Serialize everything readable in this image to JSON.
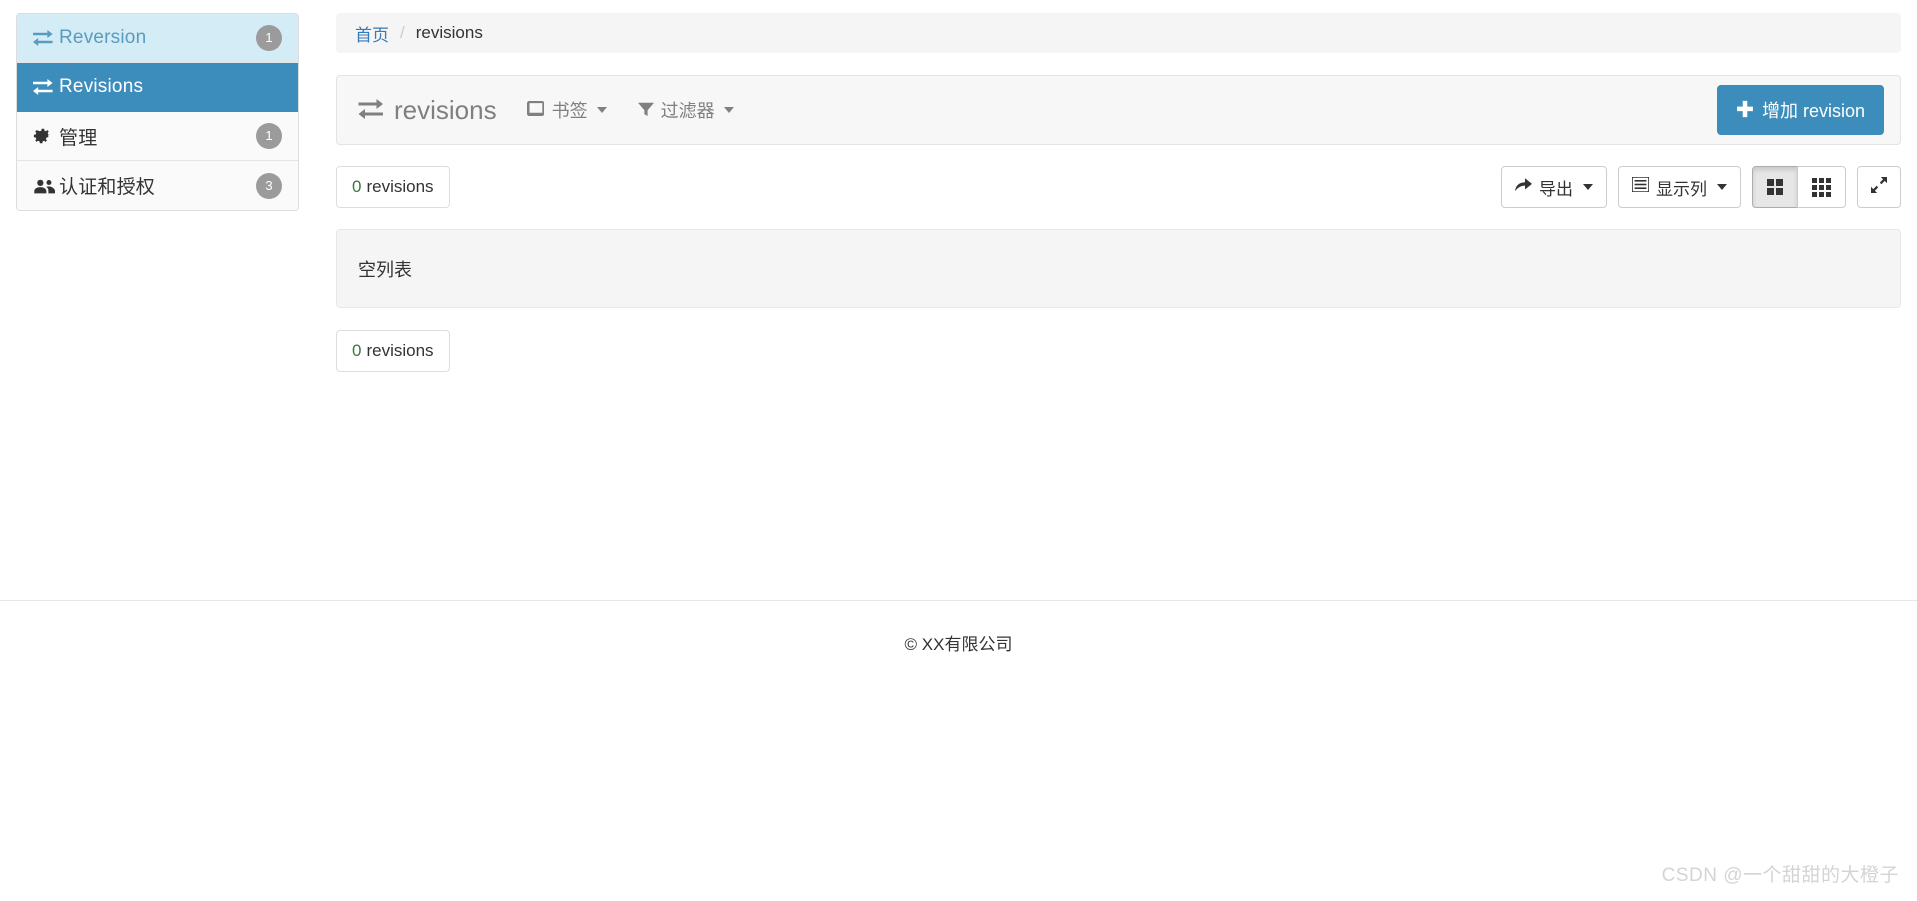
{
  "sidebar": {
    "items": [
      {
        "label": "Reversion",
        "icon": "exchange-icon",
        "badge": "1",
        "state": "open"
      },
      {
        "label": "Revisions",
        "icon": "exchange-icon",
        "badge": "",
        "state": "active"
      },
      {
        "label": "管理",
        "icon": "gear-icon",
        "badge": "1",
        "state": "normal"
      },
      {
        "label": "认证和授权",
        "icon": "users-icon",
        "badge": "3",
        "state": "normal"
      }
    ]
  },
  "breadcrumb": {
    "home": "首页",
    "separator": "/",
    "current": "revisions"
  },
  "toolbar": {
    "title": "revisions",
    "title_icon": "exchange-icon",
    "bookmarks_label": "书签",
    "bookmarks_icon": "book-icon",
    "filters_label": "过滤器",
    "filters_icon": "filter-icon",
    "add_button_label": "增加 revision",
    "add_button_icon": "plus-icon"
  },
  "results": {
    "count_number": "0",
    "count_label": "revisions",
    "export_label": "导出",
    "export_icon": "share-arrow-icon",
    "columns_label": "显示列",
    "columns_icon": "list-icon",
    "density_compact_icon": "grid-2x2-icon",
    "density_dense_icon": "grid-3x3-icon",
    "fullscreen_icon": "expand-arrows-icon"
  },
  "list": {
    "empty_message": "空列表"
  },
  "bottom": {
    "count_number": "0",
    "count_label": "revisions"
  },
  "footer": {
    "text": "© XX有限公司"
  },
  "watermark": {
    "text": "CSDN @一个甜甜的大橙子"
  },
  "colors": {
    "accent": "#3c8dbc",
    "open_bg": "#d4ecf6",
    "link": "#337ab7",
    "badge_bg": "#9b9b9b",
    "count_green": "#3c763d"
  }
}
